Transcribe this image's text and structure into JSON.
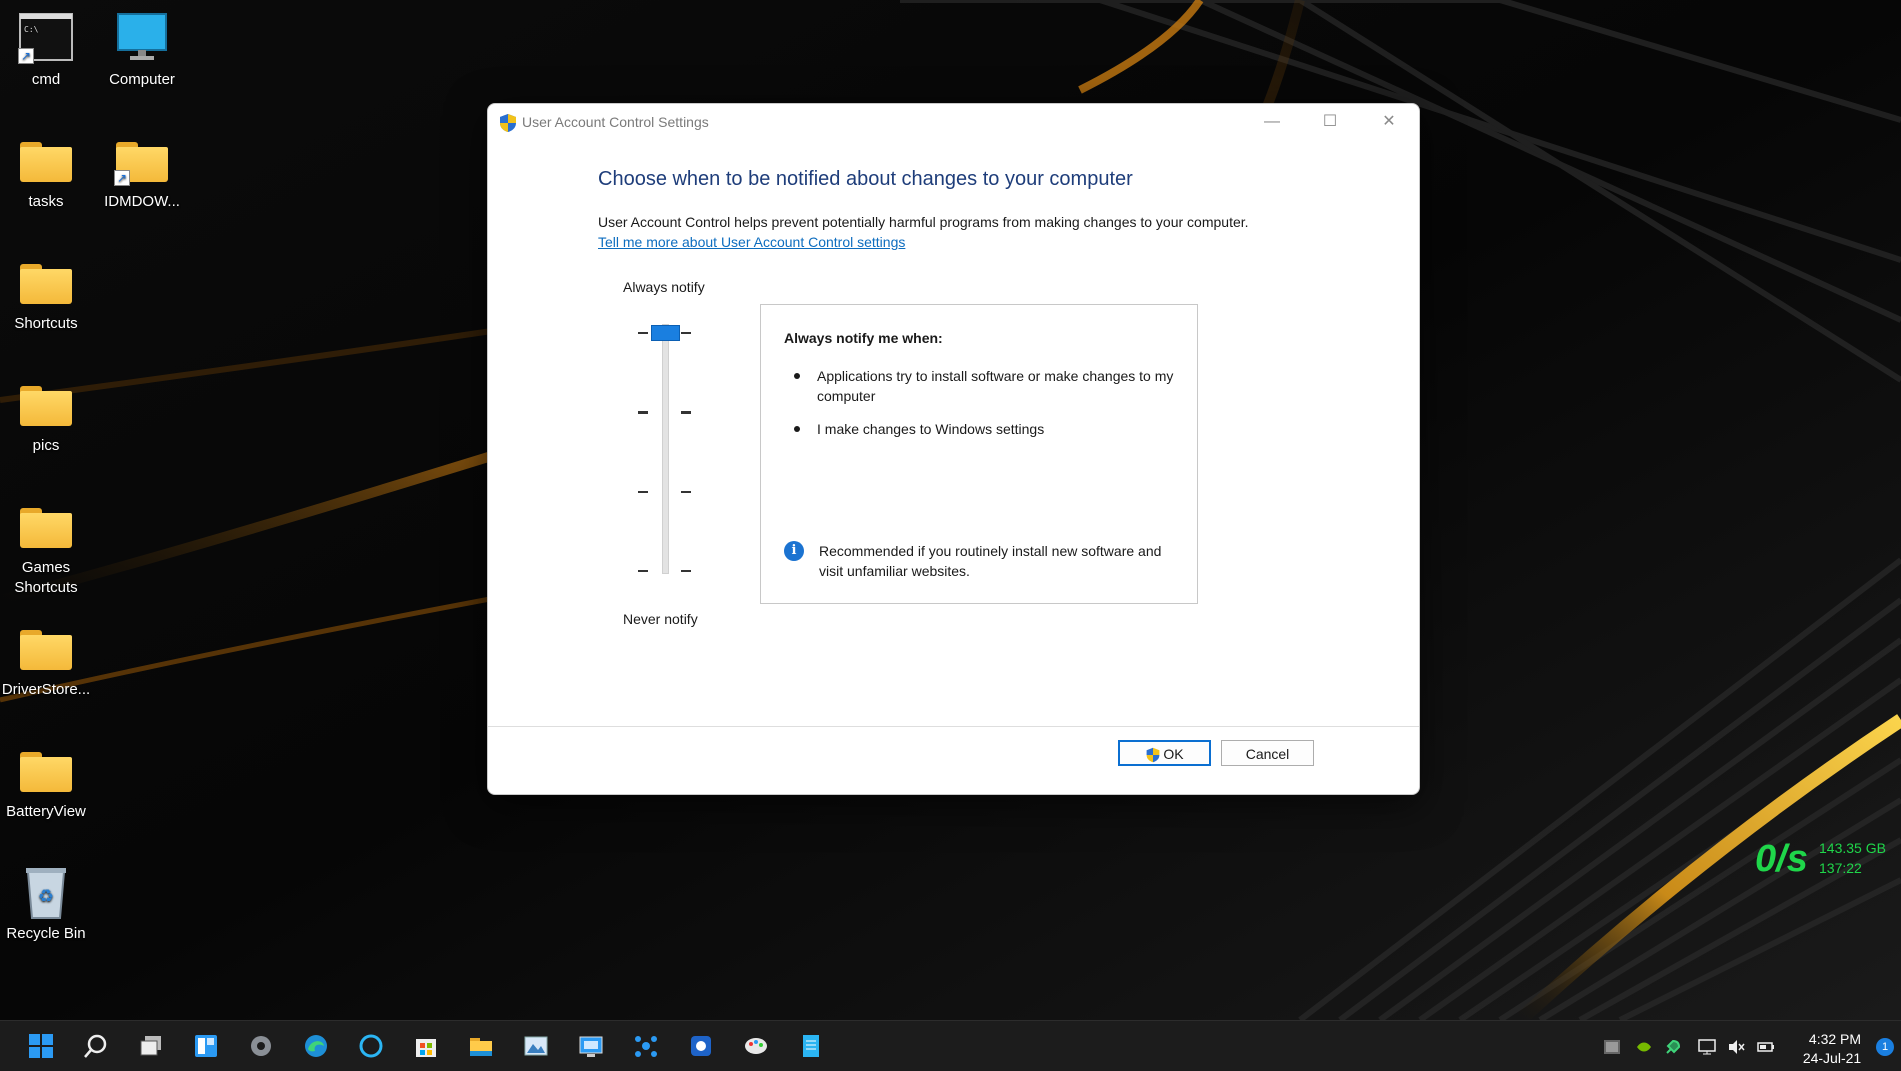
{
  "desktop": {
    "icons": [
      {
        "label": "cmd"
      },
      {
        "label": "Computer"
      },
      {
        "label": "tasks"
      },
      {
        "label": "IDMDOW..."
      },
      {
        "label": "Shortcuts"
      },
      {
        "label": "pics"
      },
      {
        "label": "Games Shortcuts"
      },
      {
        "label": "DriverStore..."
      },
      {
        "label": "BatteryView"
      },
      {
        "label": "Recycle Bin"
      }
    ]
  },
  "window": {
    "title": "User Account Control Settings",
    "controls": {
      "minimize": "—",
      "maximize": "☐",
      "close": "✕"
    },
    "heading": "Choose when to be notified about changes to your computer",
    "description": "User Account Control helps prevent potentially harmful programs from making changes to your computer.",
    "learn_more_link": "Tell me more about User Account Control settings",
    "slider": {
      "top_label": "Always notify",
      "bottom_label": "Never notify",
      "level_count": 4,
      "selected_level": 1
    },
    "panel": {
      "title": "Always notify me when:",
      "bullets": [
        "Applications try to install software or make changes to my computer",
        "I make changes to Windows settings"
      ],
      "recommendation": "Recommended if you routinely install new software and visit unfamiliar websites."
    },
    "buttons": {
      "ok": "OK",
      "cancel": "Cancel"
    }
  },
  "widget": {
    "speed": "0/s",
    "total": "143.35 GB",
    "time": "137:22"
  },
  "taskbar": {
    "clock_time": "4:32 PM",
    "clock_date": "24-Jul-21",
    "notification_count": "1"
  },
  "colors": {
    "accent": "#1a7fe0",
    "heading": "#1e3d7a",
    "link": "#0d6dbf",
    "widget_green": "#1fd64a",
    "taskbar": "#1c1c1c"
  }
}
